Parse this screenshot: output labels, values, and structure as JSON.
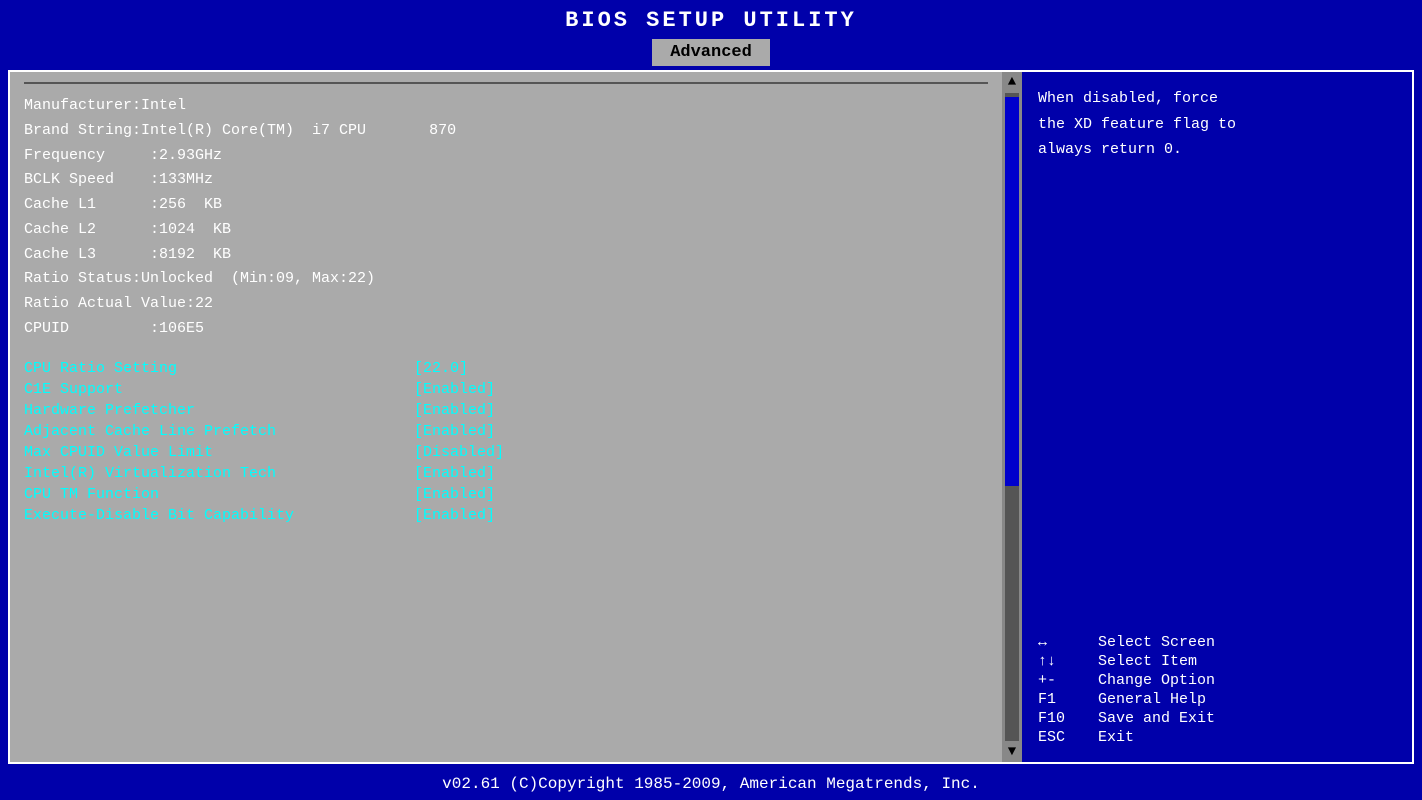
{
  "title": "BIOS  SETUP  UTILITY",
  "tab": "Advanced",
  "info": {
    "manufacturer": "Manufacturer:Intel",
    "brand_string": "Brand String:Intel(R) Core(TM)  i7 CPU       870",
    "frequency": "Frequency     :2.93GHz",
    "bclk_speed": "BCLK Speed    :133MHz",
    "cache_l1": "Cache L1      :256  KB",
    "cache_l2": "Cache L2      :1024  KB",
    "cache_l3": "Cache L3      :8192  KB",
    "ratio_status": "Ratio Status:Unlocked  (Min:09, Max:22)",
    "ratio_actual": "Ratio Actual Value:22",
    "cpuid": "CPUID         :106E5"
  },
  "menu_items": [
    {
      "label": "CPU Ratio Setting          ",
      "value": "[22.0]"
    },
    {
      "label": "C1E Support                ",
      "value": "[Enabled]"
    },
    {
      "label": "Hardware Prefetcher        ",
      "value": "[Enabled]"
    },
    {
      "label": "Adjacent Cache Line Prefetch",
      "value": "[Enabled]"
    },
    {
      "label": "Max CPUID Value Limit      ",
      "value": "[Disabled]"
    },
    {
      "label": "Intel(R) Virtualization Tech",
      "value": "[Enabled]"
    },
    {
      "label": "CPU TM Function            ",
      "value": "[Enabled]"
    },
    {
      "label": "Execute-Disable Bit Capability",
      "value": "[Enabled]"
    }
  ],
  "help_text": "When disabled, force\nthe XD feature flag to\nalways return 0.",
  "legend": [
    {
      "key": "↔",
      "desc": "  Select Screen"
    },
    {
      "key": "↑↓",
      "desc": "  Select Item"
    },
    {
      "key": "+-",
      "desc": "  Change Option"
    },
    {
      "key": "F1",
      "desc": "  General Help"
    },
    {
      "key": "F10",
      "desc": "  Save and Exit"
    },
    {
      "key": "ESC",
      "desc": "  Exit"
    }
  ],
  "footer": "v02.61  (C)Copyright 1985-2009, American Megatrends, Inc."
}
